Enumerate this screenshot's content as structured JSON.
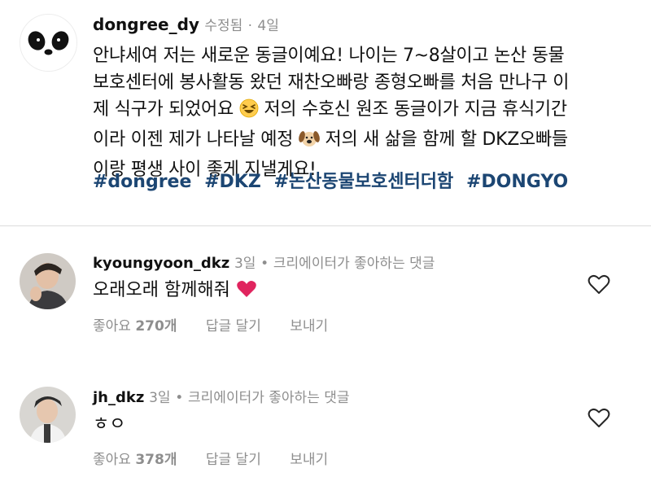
{
  "post": {
    "username": "dongree_dy",
    "edited": "수정됨",
    "dot": "·",
    "time": "4일",
    "body_line1": "안냐세여 저는 새로운 동글이예요! 나이는 7~8살이고 논산 동물",
    "body_line2": "보호센터에 봉사활동 왔던 재찬오빠랑 종형오빠를 처음 만나구 이",
    "body_line3a": "제 식구가 되었어요",
    "body_line3b": "저의 수호신 원조 동글이가 지금 휴식기간",
    "body_line4a": "이라 이젠 제가 나타날 예정",
    "body_line4b": "저의 새 삶을 함께 할 DKZ오빠들",
    "body_line5": "이랑 평생 사이 좋게 지낼게요!",
    "hashtags": [
      "#dongree",
      "#DKZ",
      "#논산동물보호센터더함",
      "#DONGYO"
    ]
  },
  "comments": [
    {
      "username": "kyoungyoon_dkz",
      "time": "3일",
      "dot": "•",
      "creator_like": "크리에이터가 좋아하는 댓글",
      "text": "오래오래 함께해줘",
      "likes_label": "좋아요",
      "likes_count": "270개",
      "reply": "답글 달기",
      "send": "보내기"
    },
    {
      "username": "jh_dkz",
      "time": "3일",
      "dot": "•",
      "creator_like": "크리에이터가 좋아하는 댓글",
      "text": "ㅎㅇ",
      "likes_label": "좋아요",
      "likes_count": "378개",
      "reply": "답글 달기",
      "send": "보내기"
    }
  ],
  "colors": {
    "hashtag": "#1c4673",
    "meta": "#8e8e8e",
    "heart": "#e0245e"
  }
}
